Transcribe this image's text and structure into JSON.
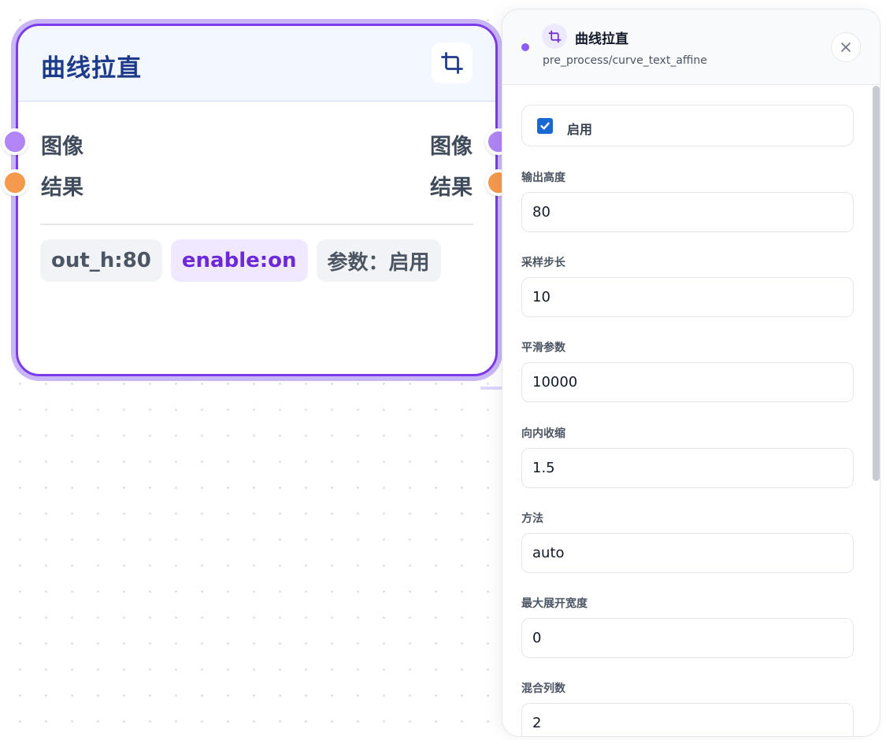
{
  "node": {
    "title": "曲线拉直",
    "icon": "crop-icon",
    "ports": [
      {
        "label": "图像",
        "color": "#b185f5"
      },
      {
        "label": "结果",
        "color": "#f59a4d"
      }
    ],
    "tags": [
      "out_h:80",
      "enable:on",
      "参数：启用"
    ]
  },
  "panel": {
    "title": "曲线拉直",
    "subtitle": "pre_process/curve_text_affine",
    "icon": "crop-icon",
    "close_icon": "close-icon",
    "enable": {
      "label": "启用",
      "checked": true
    },
    "fields": [
      {
        "label": "输出高度",
        "value": "80"
      },
      {
        "label": "采样步长",
        "value": "10"
      },
      {
        "label": "平滑参数",
        "value": "10000"
      },
      {
        "label": "向内收缩",
        "value": "1.5"
      },
      {
        "label": "方法",
        "value": "auto"
      },
      {
        "label": "最大展开宽度",
        "value": "0"
      },
      {
        "label": "混合列数",
        "value": "2"
      }
    ]
  },
  "colors": {
    "accent": "#7c3aed",
    "title": "#1e3a8a",
    "checkbox": "#1967d2"
  }
}
